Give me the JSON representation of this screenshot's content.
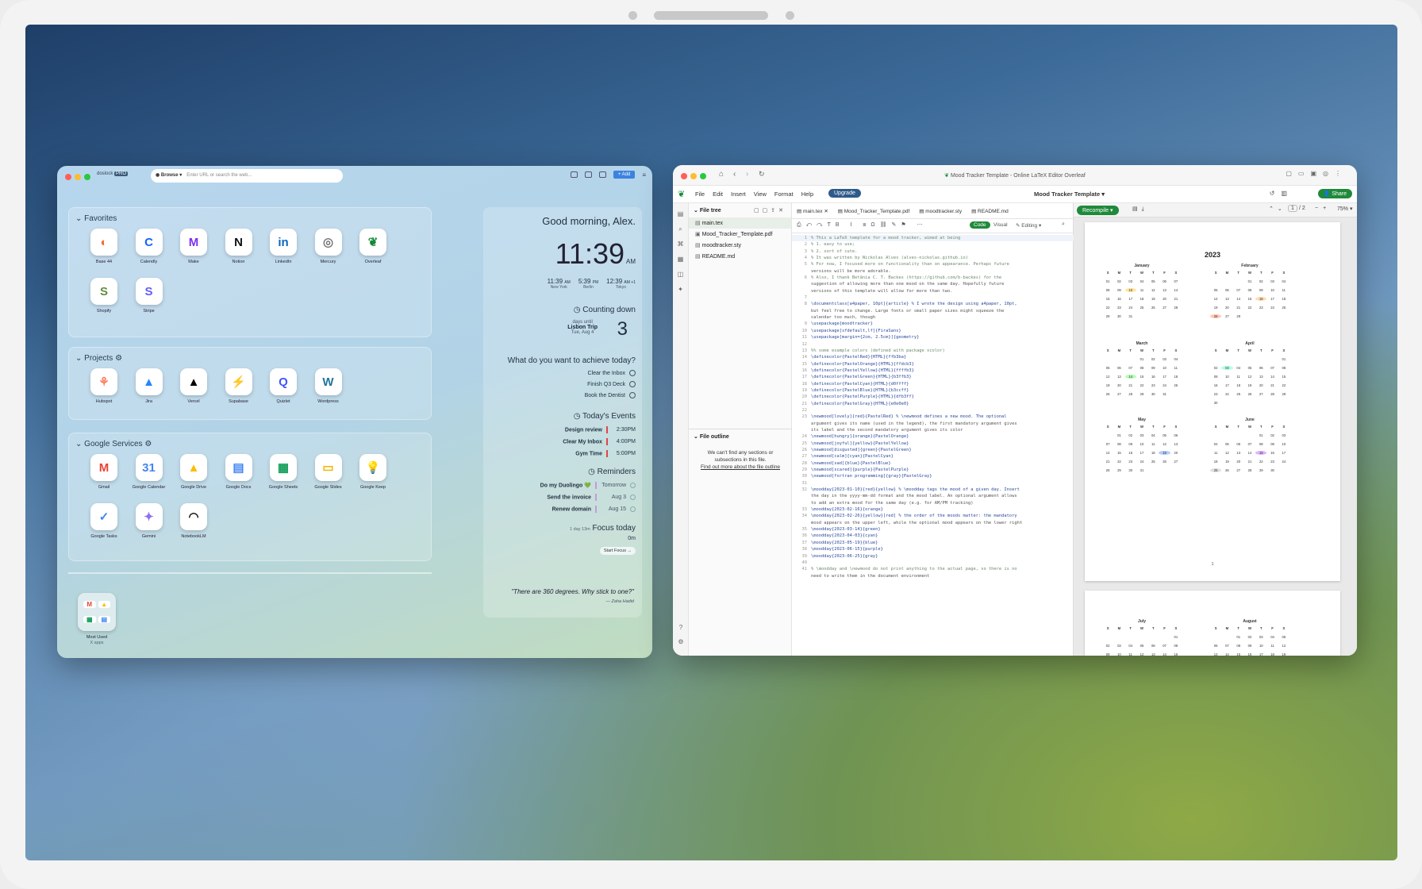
{
  "left_window": {
    "brand": "doslock",
    "brand_badge": "PRO",
    "browse": "Browse",
    "url_placeholder": "Enter URL or search the web...",
    "add": "+ Add",
    "favorites_title": "Favorites",
    "favorites": [
      {
        "label": "Base 44",
        "icon": "base44-icon",
        "color": "#f26a2e"
      },
      {
        "label": "Calendly",
        "icon": "calendly-icon",
        "color": "#1463ff"
      },
      {
        "label": "Make",
        "icon": "make-icon",
        "color": "#7b2ff2"
      },
      {
        "label": "Notion",
        "icon": "notion-icon",
        "color": "#111111"
      },
      {
        "label": "LinkedIn",
        "icon": "linkedin-icon",
        "color": "#0a66c2"
      },
      {
        "label": "Mercury",
        "icon": "mercury-icon",
        "color": "#777777"
      },
      {
        "label": "Overleaf",
        "icon": "overleaf-icon",
        "color": "#138a36"
      },
      {
        "label": "Shopify",
        "icon": "shopify-icon",
        "color": "#5e8e3e"
      },
      {
        "label": "Stripe",
        "icon": "stripe-icon",
        "color": "#635bff"
      }
    ],
    "projects_title": "Projects",
    "projects": [
      {
        "label": "Hubspot",
        "icon": "hubspot-icon",
        "color": "#ff7a59"
      },
      {
        "label": "Jira",
        "icon": "jira-icon",
        "color": "#2684ff"
      },
      {
        "label": "Vercel",
        "icon": "vercel-icon",
        "color": "#000000"
      },
      {
        "label": "Supabase",
        "icon": "supabase-icon",
        "color": "#3ecf8e"
      },
      {
        "label": "Quizlet",
        "icon": "quizlet-icon",
        "color": "#4255ff"
      },
      {
        "label": "Wordpress",
        "icon": "wordpress-icon",
        "color": "#21759b"
      }
    ],
    "google_title": "Google Services",
    "google": [
      {
        "label": "Gmail",
        "icon": "gmail-icon",
        "color": "#ea4335"
      },
      {
        "label": "Google Calendar",
        "icon": "google-calendar-icon",
        "color": "#4285f4"
      },
      {
        "label": "Google Drive",
        "icon": "google-drive-icon",
        "color": "#fbbc04"
      },
      {
        "label": "Google Docs",
        "icon": "google-docs-icon",
        "color": "#4285f4"
      },
      {
        "label": "Google Sheets",
        "icon": "google-sheets-icon",
        "color": "#0f9d58"
      },
      {
        "label": "Google Slides",
        "icon": "google-slides-icon",
        "color": "#f4b400"
      },
      {
        "label": "Google Keep",
        "icon": "google-keep-icon",
        "color": "#fbbc04"
      },
      {
        "label": "Google Tasks",
        "icon": "google-tasks-icon",
        "color": "#4285f4"
      },
      {
        "label": "Gemini",
        "icon": "gemini-icon",
        "color": "#8e6ef5"
      },
      {
        "label": "NotebookLM",
        "icon": "notebooklm-icon",
        "color": "#111111"
      }
    ],
    "most_used": "Most Used",
    "most_used_count": "X apps",
    "greeting": "Good morning, Alex.",
    "time": "11:39",
    "ampm": "AM",
    "clocks": [
      {
        "time": "11:39",
        "ap": "AM",
        "city": "New York"
      },
      {
        "time": "5:39",
        "ap": "PM",
        "city": "Berlin"
      },
      {
        "time": "12:39",
        "ap": "AM +1",
        "city": "Tokyo"
      }
    ],
    "countdown_title": "Counting down",
    "countdown_sub": "days until",
    "countdown_event": "Lisbon Trip",
    "countdown_date": "Tue, Aug 4",
    "countdown_value": "3",
    "goals_title": "What do you want to achieve today?",
    "goals": [
      "Clear the Inbox",
      "Finish Q3 Deck",
      "Book the Dentist"
    ],
    "events_title": "Today's Events",
    "events": [
      {
        "name": "Design review",
        "time": "2:30PM"
      },
      {
        "name": "Clear My Inbox",
        "time": "4:00PM"
      },
      {
        "name": "Gym Time",
        "time": "5:00PM"
      }
    ],
    "reminders_title": "Reminders",
    "reminders": [
      {
        "name": "Do my Duolingo 💚",
        "when": "Tomorrow"
      },
      {
        "name": "Send the invoice",
        "when": "Aug 3"
      },
      {
        "name": "Renew domain",
        "when": "Aug 15"
      }
    ],
    "focus_meta": "1 day   13m",
    "focus_title": "Focus today",
    "focus_value": "0m",
    "focus_btn": "Start Focus →",
    "quote": "\"There are 360 degrees. Why stick to one?\"",
    "quote_author": "— Zaha Hadid"
  },
  "right_window": {
    "title": "Mood Tracker Template - Online LaTeX Editor Overleaf",
    "menu": [
      "File",
      "Edit",
      "Insert",
      "View",
      "Format",
      "Help"
    ],
    "upgrade": "Upgrade",
    "project_name": "Mood Tracker Template",
    "share": "Share",
    "file_tree": "File tree",
    "files": [
      "main.tex",
      "Mood_Tracker_Template.pdf",
      "moodtracker.sty",
      "README.md"
    ],
    "tabs": [
      "main.tex",
      "Mood_Tracker_Template.pdf",
      "moodtracker.sty",
      "README.md"
    ],
    "mode_code": "Code",
    "mode_visual": "Visual",
    "editing": "Editing",
    "recompile": "Recompile",
    "page": "1",
    "pages": "/ 2",
    "zoom": "75%",
    "file_outline": "File outline",
    "outline_msg": "We can't find any sections or subsections in this file.",
    "outline_link": "Find out more about the file outline",
    "code": [
      [
        "1",
        "% This a LaTeX template for a mood tracker, aimed at being"
      ],
      [
        "2",
        "% 1. easy to use;"
      ],
      [
        "3",
        "% 2. sort of cute."
      ],
      [
        "4",
        "% It was written by Nickolas Alves (alves-nickolas.github.io)"
      ],
      [
        "5",
        "% For now, I focused more on functionality than on appearance. Perhaps future"
      ],
      [
        "",
        "versions will be more adorable."
      ],
      [
        "6",
        "% Also, I thank Betânia C. T. Backes (https://github.com/b-backes) for the"
      ],
      [
        "",
        "suggestion of allowing more than one mood on the same day. Hopefully future"
      ],
      [
        "",
        "versions of this template will allow for more than two."
      ],
      [
        "7",
        ""
      ],
      [
        "8",
        "\\documentclass[a4paper, 10pt]{article} % I wrote the design using a4paper, 10pt,"
      ],
      [
        "",
        "but feel free to change. Large fonts or small paper sizes might squeeze the"
      ],
      [
        "",
        "calendar too much, though"
      ],
      [
        "9",
        "\\usepackage{moodtracker}"
      ],
      [
        "10",
        "\\usepackage[sfdefault,lf]{FiraSans}"
      ],
      [
        "11",
        "\\usepackage[margin={2cm, 2.5cm}]{geometry}"
      ],
      [
        "12",
        ""
      ],
      [
        "13",
        "%% some example colors (defined with package xcolor)"
      ],
      [
        "14",
        "\\definecolor{PastelRed}{HTML}{ffb3ba}"
      ],
      [
        "15",
        "\\definecolor{PastelOrange}{HTML}{ffdcb3}"
      ],
      [
        "16",
        "\\definecolor{PastelYellow}{HTML}{ffffb3}"
      ],
      [
        "17",
        "\\definecolor{PastelGreen}{HTML}{b3ffb3}"
      ],
      [
        "18",
        "\\definecolor{PastelCyan}{HTML}{d0ffff}"
      ],
      [
        "19",
        "\\definecolor{PastelBlue}{HTML}{b3ccff}"
      ],
      [
        "20",
        "\\definecolor{PastelPurple}{HTML}{dfb3ff}"
      ],
      [
        "21",
        "\\definecolor{PastelGray}{HTML}{e0e0e0}"
      ],
      [
        "22",
        ""
      ],
      [
        "23",
        "\\newmood[lovely]{red}{PastelRed} % \\newmood defines a new mood. The optional"
      ],
      [
        "",
        "argument gives its name (used in the legend), the first mandatory argument gives"
      ],
      [
        "",
        "its label and the second mandatory argument gives its color"
      ],
      [
        "24",
        "\\newmood[hungry]{orange}{PastelOrange}"
      ],
      [
        "25",
        "\\newmood[joyful]{yellow}{PastelYellow}"
      ],
      [
        "26",
        "\\newmood[disgusted]{green}{PastelGreen}"
      ],
      [
        "27",
        "\\newmood[calm]{cyan}{PastelCyan}"
      ],
      [
        "28",
        "\\newmood[sad]{blue}{PastelBlue}"
      ],
      [
        "29",
        "\\newmood[scared]{purple}{PastelPurple}"
      ],
      [
        "30",
        "\\newmood[fortran programming]{gray}{PastelGray}"
      ],
      [
        "31",
        ""
      ],
      [
        "32",
        "\\moodday{2023-01-10}{red}{yellow} % \\moodday tags the mood of a given day. Insert"
      ],
      [
        "",
        "the day in the yyyy-mm-dd format and the mood label. An optional argument allows"
      ],
      [
        "",
        "to add an extra mood for the same day (e.g. for AM/PM tracking)"
      ],
      [
        "33",
        "\\moodday{2023-02-16}{orange}"
      ],
      [
        "34",
        "\\moodday{2023-02-26}{yellow}[red] % the order of the moods matter: the mandatory"
      ],
      [
        "",
        "mood appears on the upper left, while the optional mood appears on the lower right"
      ],
      [
        "35",
        "\\moodday{2023-03-14}{green}"
      ],
      [
        "36",
        "\\moodday{2023-04-03}{cyan}"
      ],
      [
        "37",
        "\\moodday{2023-05-19}{blue}"
      ],
      [
        "38",
        "\\moodday{2023-06-15}{purple}"
      ],
      [
        "39",
        "\\moodday{2023-06-25}{gray}"
      ],
      [
        "40",
        ""
      ],
      [
        "41",
        "% \\moodday and \\newmood do not print anything to the actual page, so there is no"
      ],
      [
        "",
        "need to write them in the document environment"
      ]
    ],
    "pdf_year": "2023",
    "pdf_page_num": "1",
    "months": [
      {
        "name": "January",
        "start": 0,
        "days": 31
      },
      {
        "name": "February",
        "start": 3,
        "days": 28
      },
      {
        "name": "March",
        "start": 3,
        "days": 31
      },
      {
        "name": "April",
        "start": 6,
        "days": 30
      },
      {
        "name": "May",
        "start": 1,
        "days": 31
      },
      {
        "name": "June",
        "start": 4,
        "days": 30
      },
      {
        "name": "July",
        "start": 6,
        "days": 31
      },
      {
        "name": "August",
        "start": 2,
        "days": 31
      }
    ],
    "weekdays": [
      "S",
      "M",
      "T",
      "W",
      "T",
      "F",
      "S"
    ],
    "highlights": [
      {
        "m": 0,
        "d": 10,
        "c": "#ffe6a0"
      },
      {
        "m": 1,
        "d": 16,
        "c": "#ffdcb3"
      },
      {
        "m": 1,
        "d": 26,
        "c": "#ffc8b0"
      },
      {
        "m": 2,
        "d": 14,
        "c": "#b3ffb3"
      },
      {
        "m": 3,
        "d": 3,
        "c": "#b3ffe0"
      },
      {
        "m": 4,
        "d": 19,
        "c": "#b3ccff"
      },
      {
        "m": 5,
        "d": 15,
        "c": "#dfb3ff"
      },
      {
        "m": 5,
        "d": 25,
        "c": "#e0e0e0"
      }
    ]
  }
}
